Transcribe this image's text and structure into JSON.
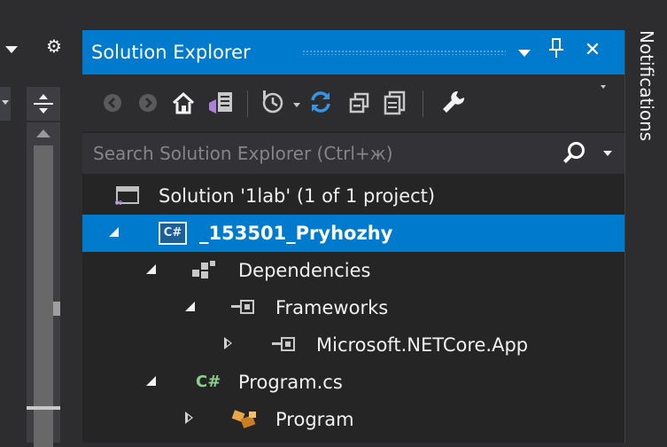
{
  "explorer": {
    "title": "Solution Explorer",
    "title_buttons": {
      "dropdown": "",
      "pin": "1",
      "close": "✕"
    }
  },
  "toolbar": {
    "back": "◀",
    "forward": "▶",
    "home": "⌂",
    "switch_views": "▤",
    "history": "◷",
    "sync": "⇄",
    "collapse": "⧉",
    "properties": "⎘",
    "settings": "⚒"
  },
  "search": {
    "placeholder": "Search Solution Explorer (Ctrl+ж)",
    "value": ""
  },
  "tree": {
    "solution": "Solution '1lab' (1 of 1 project)",
    "project": "_153501_Pryhozhy",
    "dependencies": "Dependencies",
    "frameworks": "Frameworks",
    "netcore": "Microsoft.NETCore.App",
    "program_cs": "Program.cs",
    "program_class": "Program",
    "cs_badge": "C#"
  },
  "side_panel": {
    "notifications": "Notifications"
  },
  "left_pane": {
    "gear": "⚙"
  },
  "colors": {
    "accent": "#007acc",
    "background": "#252526",
    "chrome": "#2d2d30",
    "text": "#f1f1f1"
  }
}
